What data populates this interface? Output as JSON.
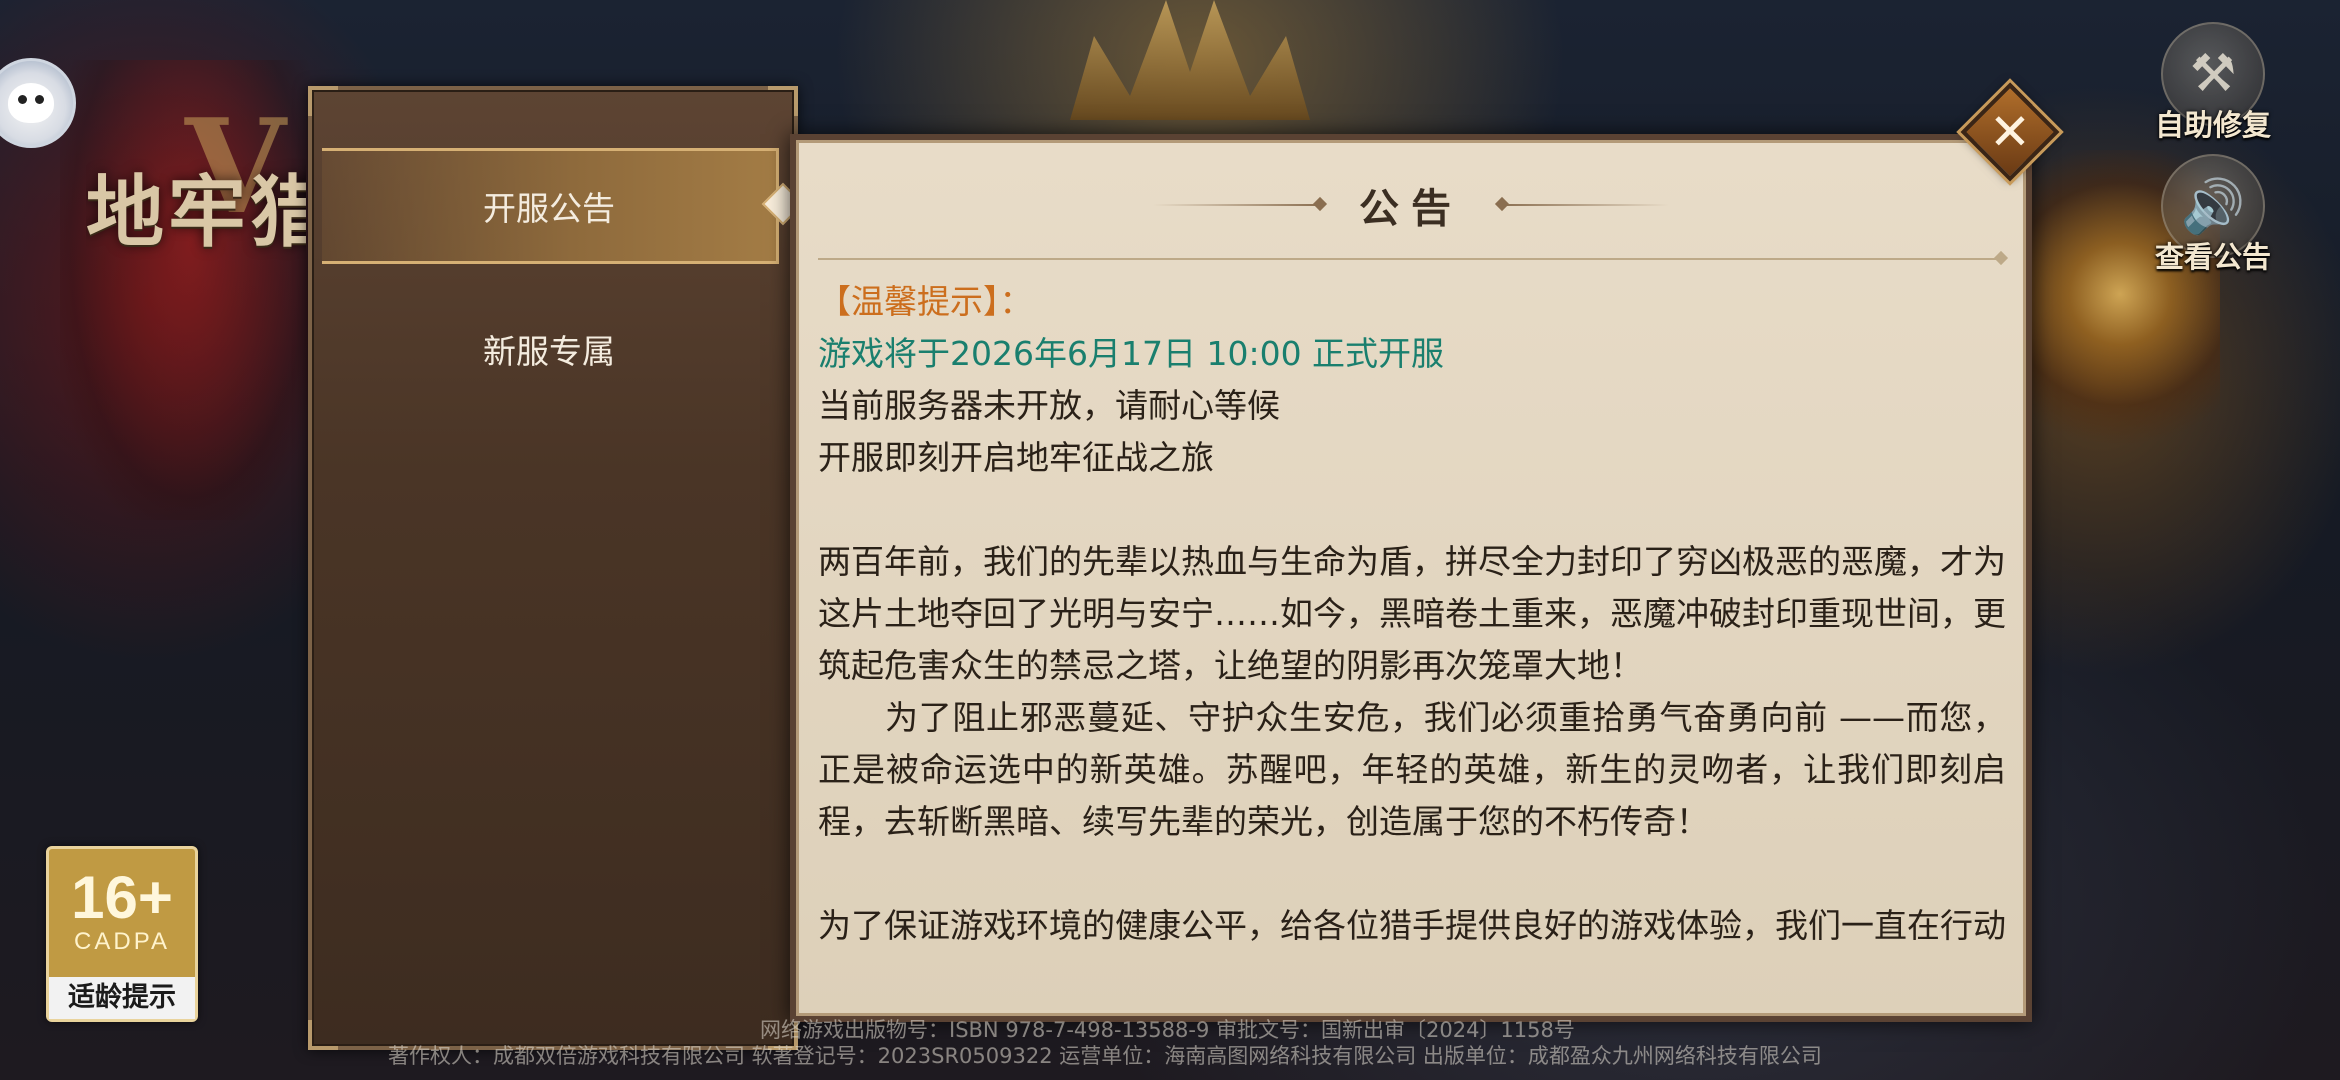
{
  "logo": {
    "title": "地牢猎",
    "roman": "V"
  },
  "age_badge": {
    "rating": "16+",
    "org": "CADPA",
    "label": "适龄提示"
  },
  "tools": [
    {
      "label": "自助修复",
      "icon": "wrench-icon"
    },
    {
      "label": "查看公告",
      "icon": "speaker-icon"
    }
  ],
  "tabs": [
    {
      "label": "开服公告",
      "active": true
    },
    {
      "label": "新服专属",
      "active": false
    }
  ],
  "notice": {
    "title": "公告",
    "tip_title": "【温馨提示】：",
    "open_line": "游戏将于2026年6月17日 10:00 正式开服",
    "line1": "当前服务器未开放，请耐心等候",
    "line2": "开服即刻开启地牢征战之旅",
    "para1": "两百年前，我们的先辈以热血与生命为盾，拼尽全力封印了穷凶极恶的恶魔，才为这片土地夺回了光明与安宁……如今，黑暗卷土重来，恶魔冲破封印重现世间，更筑起危害众生的禁忌之塔，让绝望的阴影再次笼罩大地！",
    "para2": "      为了阻止邪恶蔓延、守护众生安危，我们必须重拾勇气奋勇向前 ——而您，正是被命运选中的新英雄。苏醒吧，年轻的英雄，新生的灵吻者，让我们即刻启程，去斩断黑暗、续写先辈的荣光，创造属于您的不朽传奇！",
    "para3": "为了保证游戏环境的健康公平，给各位猎手提供良好的游戏体验，我们一直在行动"
  },
  "footer": {
    "line1": "网络游戏出版物号：ISBN 978-7-498-13588-9  审批文号：国新出审〔2024〕1158号",
    "line2": "著作权人：成都双倍游戏科技有限公司  软著登记号：2023SR0509322  运营单位：海南高图网络科技有限公司  出版单位：成都盈众九州网络科技有限公司"
  }
}
